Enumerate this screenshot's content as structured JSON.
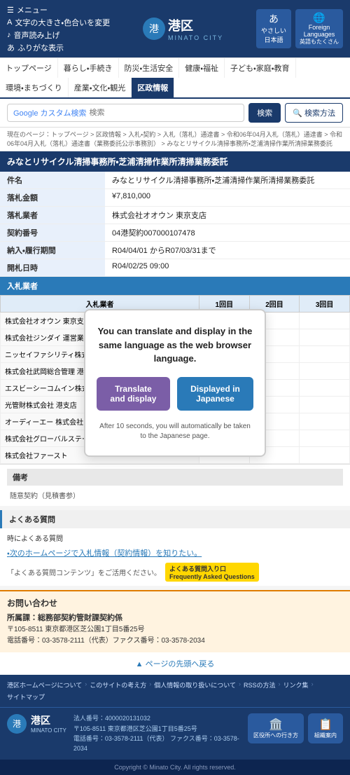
{
  "header": {
    "menu_label": "メニュー",
    "menu_items": [
      {
        "label": "文字の大きさ・色合いを変更",
        "icon": "A"
      },
      {
        "label": "音声読み上げ",
        "icon": "♪"
      },
      {
        "label": "ふりがな表示",
        "icon": "あ"
      }
    ],
    "logo_circle": "港",
    "logo_name": "港区",
    "logo_sub": "MINATO CITY",
    "lang_btn1_icon": "あ",
    "lang_btn1_line1": "やさしい",
    "lang_btn1_line2": "日本語",
    "lang_btn2_icon": "🌐",
    "lang_btn2_line1": "Foreign",
    "lang_btn2_line2": "Languages",
    "lang_btn2_line3": "英語もたくさん"
  },
  "nav": {
    "items": [
      {
        "label": "トップページ",
        "active": false
      },
      {
        "label": "暮らし・手続き",
        "active": false
      },
      {
        "label": "防災・生活安全",
        "active": false
      },
      {
        "label": "健康・福祉",
        "active": false
      },
      {
        "label": "子ども・家庭・教育",
        "active": false
      },
      {
        "label": "環境・まちづくり",
        "active": false
      },
      {
        "label": "産業・文化・観光",
        "active": false
      },
      {
        "label": "区政情報",
        "active": true
      }
    ]
  },
  "search": {
    "google_label": "Google カスタム検索",
    "placeholder": "検索",
    "btn_label": "検索",
    "method_btn": "🔍 検索方法"
  },
  "breadcrumb": {
    "text": "現在のページ：トップページ > 区政情報 > 入札・契約 > 入札（落札）通達書 > 令和06年04月入札（落札）通達書 > 令和06年04月入札（落札）通達書（業務委託公示事務別） > みなとリサイクル清掃事務所・芝浦清掃作業所清掃業務委託"
  },
  "page_title": "みなとリサイクル清掃事務所・芝浦清掃作業所清掃業務委託",
  "info_table": {
    "rows": [
      {
        "label": "件名",
        "value": "みなとリサイクル清掃事務所・芝浦清掃作業所清掃業務委託"
      },
      {
        "label": "落札金額",
        "value": "¥7,810,000"
      },
      {
        "label": "落札業者",
        "value": "株式会社オオウン 東京支店"
      },
      {
        "label": "契約番号",
        "value": "04港契約007000107478"
      },
      {
        "label": "納入・履行期間",
        "value": "R04/04/01 からR07/03/31まで"
      },
      {
        "label": "開札日時",
        "value": "R04/02/25 09:00"
      }
    ]
  },
  "bid_section": {
    "header": "入札業者",
    "col_headers": [
      "入札業者",
      "1回目",
      "2回目",
      "3回目"
    ],
    "rows": [
      {
        "company": "株式会社オオウン 東京支店",
        "r1": "",
        "r2": "",
        "r3": ""
      },
      {
        "company": "株式会社ジンダイ 運営業所",
        "r1": "",
        "r2": "",
        "r3": ""
      },
      {
        "company": "ニッセイファシリティ株式会社",
        "r1": "",
        "r2": "",
        "r3": ""
      },
      {
        "company": "株式会社武岡総合管理 港支店",
        "r1": "",
        "r2": "",
        "r3": ""
      },
      {
        "company": "エスビーシーコムイン株式会社",
        "r1": "",
        "r2": "",
        "r3": ""
      },
      {
        "company": "光管財株式会社 港支店",
        "r1": "",
        "r2": "",
        "r3": ""
      },
      {
        "company": "オーディーエー 株式会社",
        "r1": "",
        "r2": "",
        "r3": ""
      },
      {
        "company": "株式会社グローバルステージ",
        "r1": "",
        "r2": "",
        "r3": ""
      },
      {
        "company": "株式会社ファースト",
        "r1": "",
        "r2": "",
        "r3": ""
      }
    ]
  },
  "translation_modal": {
    "text": "You can translate and display in the same language as the web browser language.",
    "btn_translate": "Translate and display",
    "btn_displayed": "Displayed in Japanese",
    "note": "After 10 seconds, you will automatically be taken to the Japanese page."
  },
  "remarks": {
    "header": "備考",
    "text": "随意契約（見積書参）"
  },
  "faq": {
    "header": "よくある質問",
    "section_label": "時によくある質問",
    "faq_item": "次のホームページで入札情報（契約情報）を知りたい。",
    "faq_link_text": "「よくある質問コンテンツ」をご活用ください。",
    "faq_badge": "よくある質問入り口\nFrequently Asked Questions"
  },
  "contact": {
    "header": "お問い合わせ",
    "dept": "所属課：総務部契約管財課契約係",
    "address": "〒105-8511 東京都港区芝公園1丁目5番25号",
    "phone": "電話番号：03-3578-2111（代表）ファクス番号：03-3578-2034"
  },
  "back_to_top": {
    "arrow": "▲",
    "label": "ページの先頭へ戻る"
  },
  "footer_nav": {
    "items": [
      {
        "label": "港区ホームページについて"
      },
      {
        "label": "このサイトの考え方"
      },
      {
        "label": "個人情報の取り扱いについて"
      },
      {
        "label": "RSSの方法"
      },
      {
        "label": "リンク集"
      },
      {
        "label": "サイトマップ"
      }
    ]
  },
  "footer": {
    "logo_circle": "港",
    "logo_name": "港区",
    "logo_sub": "MINATO CITY",
    "corp_number_label": "法人番号：4000020131032",
    "address": "〒105-8511 東京都港区芝公園1丁目5番25号",
    "phone": "電話番号：03-3578-2111（代表） ファクス番号：03-3578-2034",
    "btn1_icon": "🏠",
    "btn1_label": "区役所への行き方",
    "btn2_icon": "📋",
    "btn2_label": "組織案内",
    "copyright": "Copyright © Minato City. All rights reserved."
  }
}
